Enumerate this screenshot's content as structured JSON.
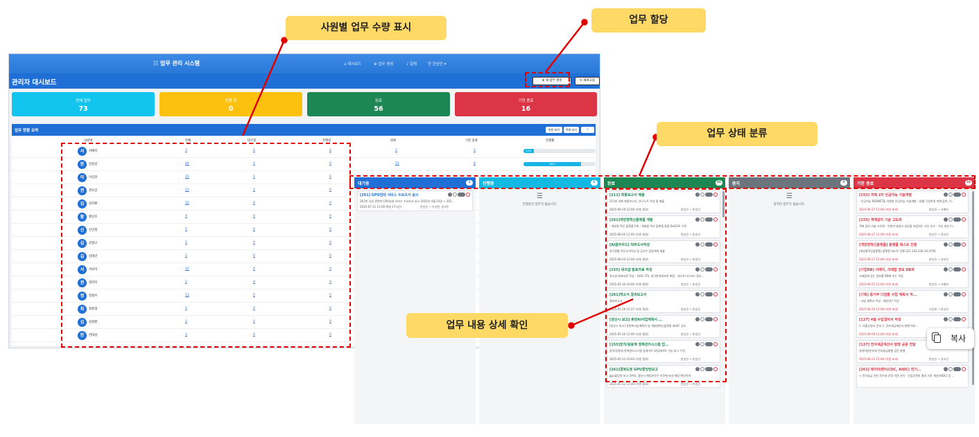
{
  "app": {
    "brand": "☷ 업무 관리 시스템",
    "nav": [
      {
        "label": "⌂ 대시보드"
      },
      {
        "label": "⊕ 업무 생성"
      },
      {
        "label": "♪ 알림"
      },
      {
        "label": "한 한승민 ▾"
      }
    ],
    "page_title": "관리자 대시보드",
    "new_task_button": "⊕ 새 업무 생성",
    "refresh_button": "↻ 새로고침"
  },
  "stat_cards": [
    {
      "label": "전체 업무",
      "value": "73",
      "color": "#11c5ee"
    },
    {
      "label": "진행 중",
      "value": "0",
      "color": "#fcc10e"
    },
    {
      "label": "완료",
      "value": "56",
      "color": "#1d8754"
    },
    {
      "label": "기한 종료",
      "value": "16",
      "color": "#db3546"
    }
  ],
  "summary": {
    "title": "업무 현황 요약",
    "toggle_buttons": [
      "편번 보기",
      "목록 보기",
      "^"
    ],
    "columns": [
      "사원명",
      "전체",
      "대기중",
      "진행중",
      "완료",
      "기한 종료",
      "진행률"
    ],
    "rows": [
      {
        "avatar": "서",
        "name": "서예지",
        "total": "3",
        "waiting": "0",
        "progress": "0",
        "done": "3",
        "overdue": "4",
        "rate": 0.14,
        "rate_label": "14%"
      },
      {
        "avatar": "한",
        "name": "한승민",
        "total": "44",
        "waiting": "1",
        "progress": "0",
        "done": "31",
        "overdue": "8",
        "rate": 0.8,
        "rate_label": "80%"
      },
      {
        "avatar": "이",
        "name": "이상현",
        "total": "15",
        "waiting": "1",
        "progress": "0"
      },
      {
        "avatar": "권",
        "name": "권오민",
        "total": "13",
        "waiting": "1",
        "progress": "0"
      },
      {
        "avatar": "김",
        "name": "김지환",
        "total": "12",
        "waiting": "0",
        "progress": "0"
      },
      {
        "avatar": "황",
        "name": "황상호",
        "total": "4",
        "waiting": "0",
        "progress": "0"
      },
      {
        "avatar": "신",
        "name": "신인정",
        "total": "5",
        "waiting": "0",
        "progress": "0"
      },
      {
        "avatar": "김",
        "name": "김형규",
        "total": "1",
        "waiting": "0",
        "progress": "0"
      },
      {
        "avatar": "김",
        "name": "김대년",
        "total": "5",
        "waiting": "0",
        "progress": "0"
      },
      {
        "avatar": "서",
        "name": "서요덕",
        "total": "10",
        "waiting": "0",
        "progress": "0"
      },
      {
        "avatar": "권",
        "name": "권리지",
        "total": "2",
        "waiting": "0",
        "progress": "0"
      },
      {
        "avatar": "정",
        "name": "정철우",
        "total": "11",
        "waiting": "0",
        "progress": "0"
      },
      {
        "avatar": "최",
        "name": "최준형",
        "total": "1",
        "waiting": "0",
        "progress": "0"
      },
      {
        "avatar": "김",
        "name": "김창환",
        "total": "1",
        "waiting": "0",
        "progress": "0"
      },
      {
        "avatar": "한",
        "name": "한대성",
        "total": "1",
        "waiting": "0",
        "progress": "0"
      }
    ]
  },
  "kanban": {
    "columns": [
      {
        "title": "대기중",
        "count": "1",
        "color": "#1f6fd6"
      },
      {
        "title": "진행중",
        "count": "0",
        "color": "#12b9e3",
        "empty_text": "진행중인 업무가 없습니다."
      },
      {
        "title": "완료",
        "count": "56",
        "color": "#1d8754"
      },
      {
        "title": "중지",
        "count": "0",
        "color": "#6c757d",
        "empty_text": "중지된 업무가 없습니다."
      },
      {
        "title": "기한 종료",
        "count": "16",
        "color": "#db3546"
      }
    ],
    "waiting_cards": [
      {
        "title": "[261] GPU임대 서비스 수요조사 실시",
        "desc": "261번 사업 관련한 GPU임대 서비스 수요조사 실시 2025년 4월 23일 ~ 202...",
        "date": "2025-07-11 12:00 (9일 17시간)",
        "owner": "한승민 → 이상현, 권오민"
      }
    ],
    "done_cards": [
      {
        "title": "[211] 최종보고서 제출",
        "desc": "211번 과제 최종보고서, 연구노트 작성 및 제출",
        "date": "2025-06-19 12:00 (기한 종료)",
        "owner": "한승민 → 한승민"
      },
      {
        "title": "[261]개방형혁신플랫폼 개발",
        "desc": "- 개방형 혁신 플랫폼구축 - 개방형 혁신 플랫폼 통합 BeGS로 수정",
        "date": "2025-06-05 12:00 (기한 종료)",
        "owner": "한승민 → 한승민"
      },
      {
        "title": "[AI클라우드] 직무조서작성",
        "desc": "연구원별 직무조서작성 및 김선우 팀장에게 제출",
        "date": "2025-06-03 12:00 (기한 종료)",
        "owner": "한승민 → 한승민"
      },
      {
        "title": "[155] 워크샵 발표자료 작성",
        "desc": "워크샵 발표자료 작성 - GOS, ITS, 대구한하대자료 취합 - 테스트시나리오 정리...",
        "date": "2025-05-30 18:00 (기한 종료)",
        "owner": "한승민 → 한승민"
      },
      {
        "title": "[261]개소식 결과보고서",
        "desc": "결과보고서",
        "date": "2025-05-29 12:27 (기한 종료)",
        "owner": "한승민 → 한승민"
      },
      {
        "title": "[생산시 보고] 휴먼AI사업계획서 ...",
        "desc": "[생산시 보고] 휴먼AI사업계획서 및 개방형혁신플랫폼 새버트 공유",
        "date": "2025-05-16 12:00 (기한 종료)",
        "owner": "한승민 → 한승민"
      },
      {
        "title": "[155]장치/응용체 정책관리시스템 업...",
        "desc": "장치/응용체 정책관리시스템 업데이트 UI업데이트 기능 버그 수정",
        "date": "2025-05-12 10:03 (기한 종료)",
        "owner": "한승민 → 한승민"
      },
      {
        "title": "[261]경북도청 GPU할당방보고",
        "desc": "gpu할당방 보고 경북도 경산시 해킹보안구 이전에 보낸 해킹 확인하여",
        "date": "2025-05-12 11:00 (기한 종료)",
        "owner": "한승민 → 한승민"
      }
    ],
    "overdue_cards": [
      {
        "title": "[155] 과제 2차 인공지능 기술개발",
        "desc": "- 인공지능 RESNET을 이용한 인공지능 기술개발 - UI를 구성하여 개체 탐지, 이...",
        "date": "2025-06-27 12:00 (기한 초과)",
        "owner": "한승민 → 서예지"
      },
      {
        "title": "[155] 객체감지 기술 고도화",
        "desc": "객체 감지 기술 고도화 - 악변의 발생시 영상을 저장하는 기능 추가 - 기능 개선 이...",
        "date": "2025-06-27 12:00 (기한 초과)",
        "owner": "한승민 → 권오민"
      },
      {
        "title": "[개방형혁신플랫폼] 플랫폼 테스트 진행",
        "desc": "[개방형혁신플랫폼] 플랫폼 테스트 진행 221.142.226.10:3700",
        "date": "2025-06-27 12:00 (기한 초과)",
        "owner": "한승민 → 권오민"
      },
      {
        "title": "[기업DB] 서예지, 크레탑 정보 DB화",
        "desc": "크레탑에 있는 정보를 DB화 하는 작업",
        "date": "2025-06-25 12:00 (기한 초과)",
        "owner": "한승민 → 서예지"
      },
      {
        "title": "[기획] 중기부 디딤돌 사업 계획서 작...",
        "desc": "- 사업 계획서 작성 - 예산(안) 작성",
        "date": "2025-06-24 12:00 (기한 초과)",
        "owner": "이상현 → 한승민"
      },
      {
        "title": "[127] 4월 수입결의서 작성",
        "desc": "1. 미출신청서 준비 2. 전자세금계산서 발행 여부...",
        "date": "2025-06-09 12:00 (기한 초과)",
        "owner": "한승민 → 한승민"
      },
      {
        "title": "[127] 전자세금계산서 발행 공문 전달",
        "desc": "경영지원본부에 전자세금발행 공문 발행",
        "date": "2025-06-23 12:00 (기한 초과)",
        "owner": "한승민 → 권오민"
      },
      {
        "title": "[261] 데이터센터(CDC, AIDC) 전기...",
        "desc": "< 전기요금 인한 전기세 인정 의견 신탁 - 인입추천의 결과 기준 계산(AIDC) 등 ...",
        "date": "",
        "owner": ""
      }
    ]
  },
  "annotations": {
    "employee_counts": "사원별 업무 수량 표시",
    "assign_task": "업무 할당",
    "status_classification": "업무 상태 분류",
    "detail_view": "업무 내용 상세 확인"
  },
  "copy_button": "복사"
}
